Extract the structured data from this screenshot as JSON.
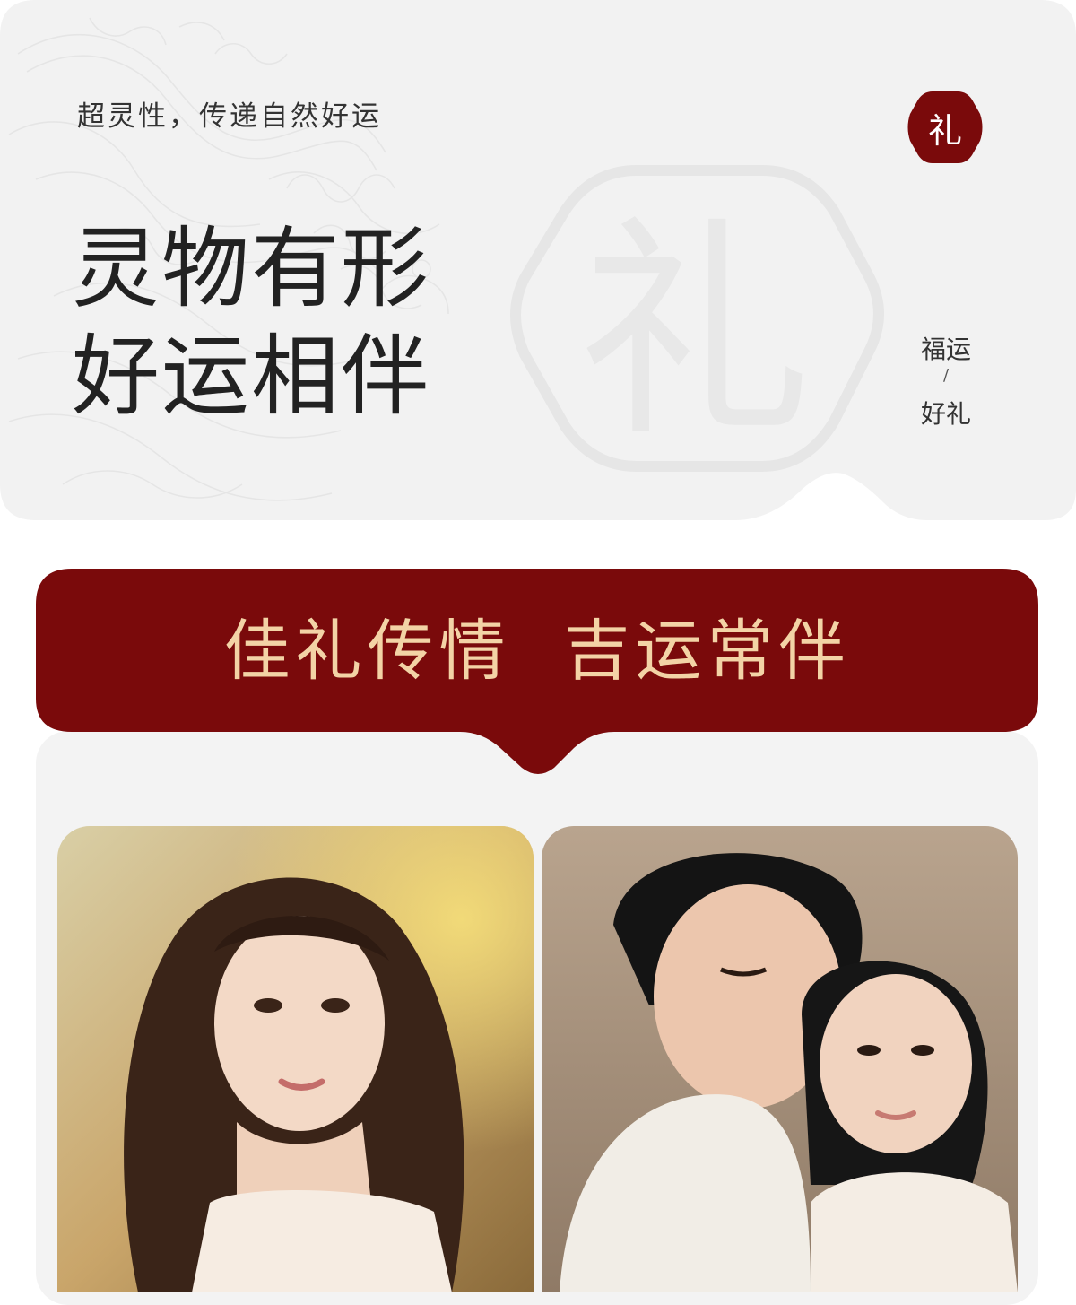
{
  "hero": {
    "slogan": "超灵性，传递自然好运",
    "headline_line1": "灵物有形",
    "headline_line2": "好运相伴",
    "seal_char": "礼",
    "side_top": "福运",
    "side_sep": "/",
    "side_bottom": "好礼"
  },
  "banner": {
    "text": "佳礼传情  吉运常伴"
  },
  "photos": [
    {
      "name": "woman-portrait-photo"
    },
    {
      "name": "couple-portrait-photo"
    }
  ],
  "colors": {
    "card_bg": "#f2f2f2",
    "brand_red": "#7a0a0b",
    "banner_text": "#f3d3a6",
    "headline": "#222222"
  }
}
